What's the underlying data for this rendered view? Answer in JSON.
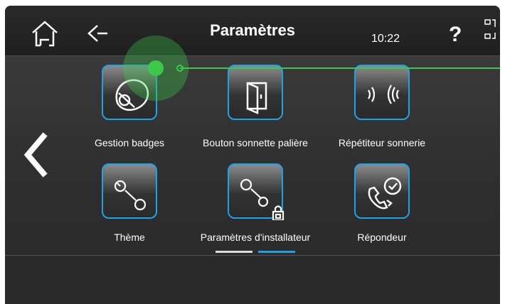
{
  "header": {
    "title": "Paramètres",
    "time": "10:22",
    "help": "?"
  },
  "icons": {
    "home": "home-icon",
    "back": "back-arrow-icon",
    "screen": "screen-toggle-icon",
    "prev": "chevron-left-icon"
  },
  "tiles": [
    {
      "label": "Gestion badges",
      "icon": "badge-icon"
    },
    {
      "label": "Bouton sonnette palière",
      "icon": "door-icon"
    },
    {
      "label": "Répétiteur sonnerie",
      "icon": "ring-repeater-icon"
    },
    {
      "label": "Thème",
      "icon": "wrench-icon"
    },
    {
      "label": "Paramètres d'installateur",
      "icon": "locked-wrench-icon"
    },
    {
      "label": "Répondeur",
      "icon": "answering-machine-icon"
    }
  ],
  "pagination": {
    "pages": 2,
    "current": 2
  },
  "colors": {
    "accent": "#1ea3e8",
    "touch": "#3cc84a"
  }
}
